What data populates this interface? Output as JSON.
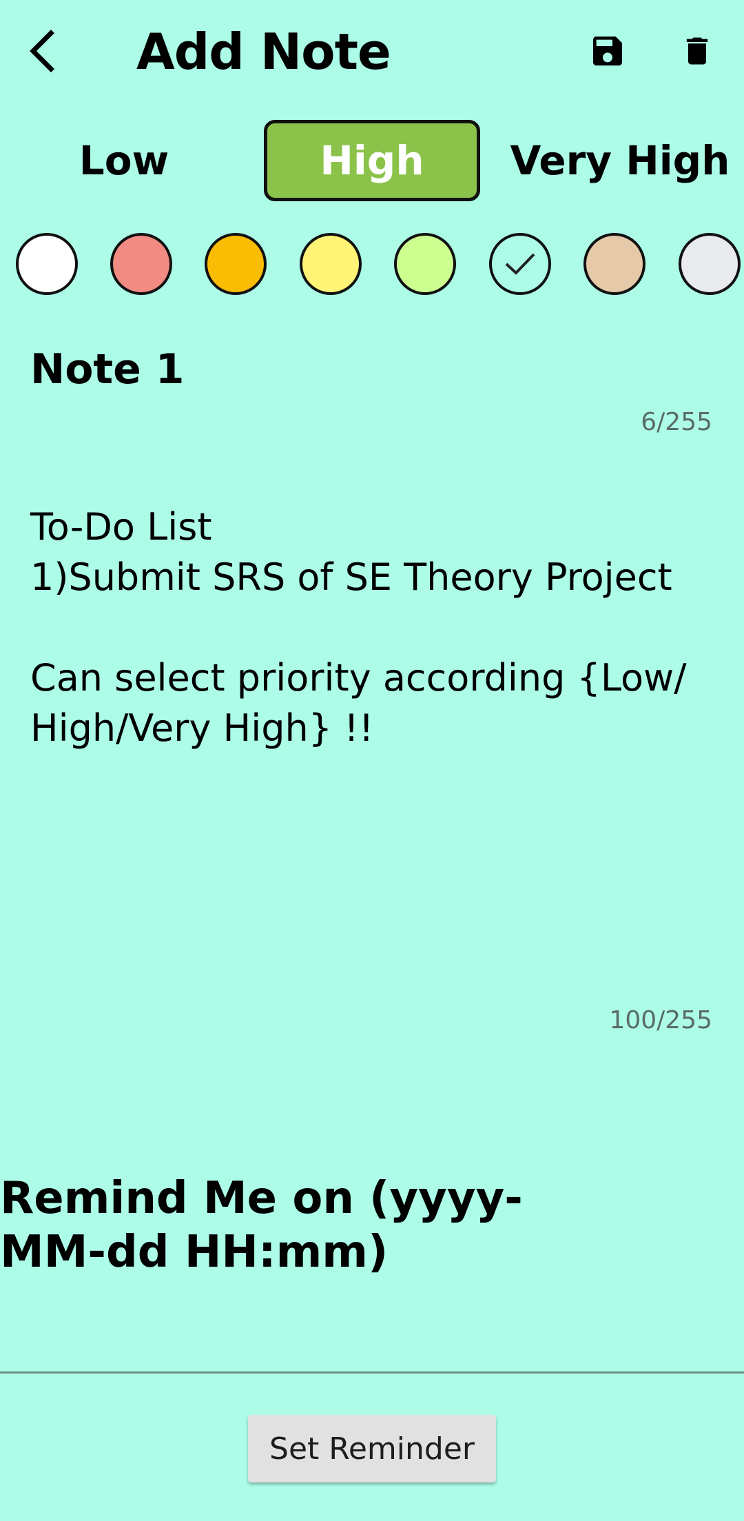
{
  "header": {
    "title": "Add Note",
    "back_icon": "chevron-left-icon",
    "save_icon": "save-icon",
    "delete_icon": "trash-icon"
  },
  "priority": {
    "options": [
      "Low",
      "High",
      "Very High"
    ],
    "selected": "High",
    "selected_color": "#8bc34a"
  },
  "colors": {
    "swatches": [
      "#ffffff",
      "#f28b82",
      "#fbbc04",
      "#fff475",
      "#ccff90",
      "#acfce8",
      "#e6c9a8",
      "#e8eaed"
    ],
    "selected_index": 5,
    "check_icon": "check-icon"
  },
  "note": {
    "title": "Note 1",
    "title_counter": "6/255",
    "body": "To-Do List\n1)Submit SRS of SE Theory Project\n\nCan select priority according {Low/\nHigh/Very High} !!",
    "body_counter": "100/255"
  },
  "reminder": {
    "label": "Remind Me on (yyyy-MM-dd HH:mm)",
    "button_label": "Set Reminder"
  },
  "theme": {
    "background": "#acfce8"
  }
}
